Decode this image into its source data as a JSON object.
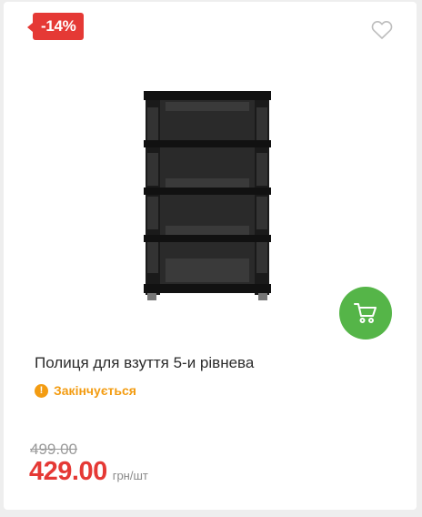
{
  "badge": {
    "discount": "-14%"
  },
  "icons": {
    "favorite": "heart-outline-icon",
    "cart": "shopping-cart-icon",
    "status": "exclamation-icon"
  },
  "product": {
    "title": "Полиця для взуття 5-и рівнева",
    "status": "Закінчується",
    "old_price": "499.00",
    "price": "429.00",
    "unit": "грн/шт"
  },
  "colors": {
    "badge": "#e53935",
    "price": "#e53935",
    "cart_button": "#55b548",
    "status": "#f39c12"
  }
}
